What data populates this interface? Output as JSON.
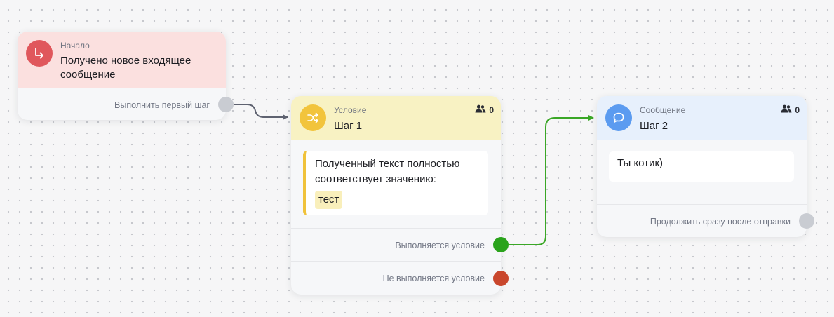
{
  "colors": {
    "start_header": "#fbe0df",
    "start_icon": "#e0575c",
    "condition_header": "#f8f2c3",
    "condition_icon": "#f2c43c",
    "message_header": "#e7f0fc",
    "message_icon": "#5b9bf0",
    "port_true": "#2aa31c",
    "port_false": "#c9472d",
    "port_idle": "#c9ccd2",
    "link_default": "#5e6270",
    "link_active": "#3aa726"
  },
  "start_node": {
    "icon": "arrow-turn-right-icon",
    "kind": "Начало",
    "title": "Получено новое входящее сообщение",
    "port_label": "Выполнить первый шаг"
  },
  "condition_node": {
    "icon": "shuffle-icon",
    "kind": "Условие",
    "title": "Шаг 1",
    "counter_icon": "users-icon",
    "counter": "0",
    "condition_text": "Полученный текст полностью соответствует значению:",
    "condition_value": "тест",
    "port_true_label": "Выполняется условие",
    "port_false_label": "Не выполняется условие"
  },
  "message_node": {
    "icon": "chat-bubble-icon",
    "kind": "Сообщение",
    "title": "Шаг 2",
    "counter_icon": "users-icon",
    "counter": "0",
    "message_text": "Ты котик)",
    "port_label": "Продолжить сразу после отправки"
  }
}
